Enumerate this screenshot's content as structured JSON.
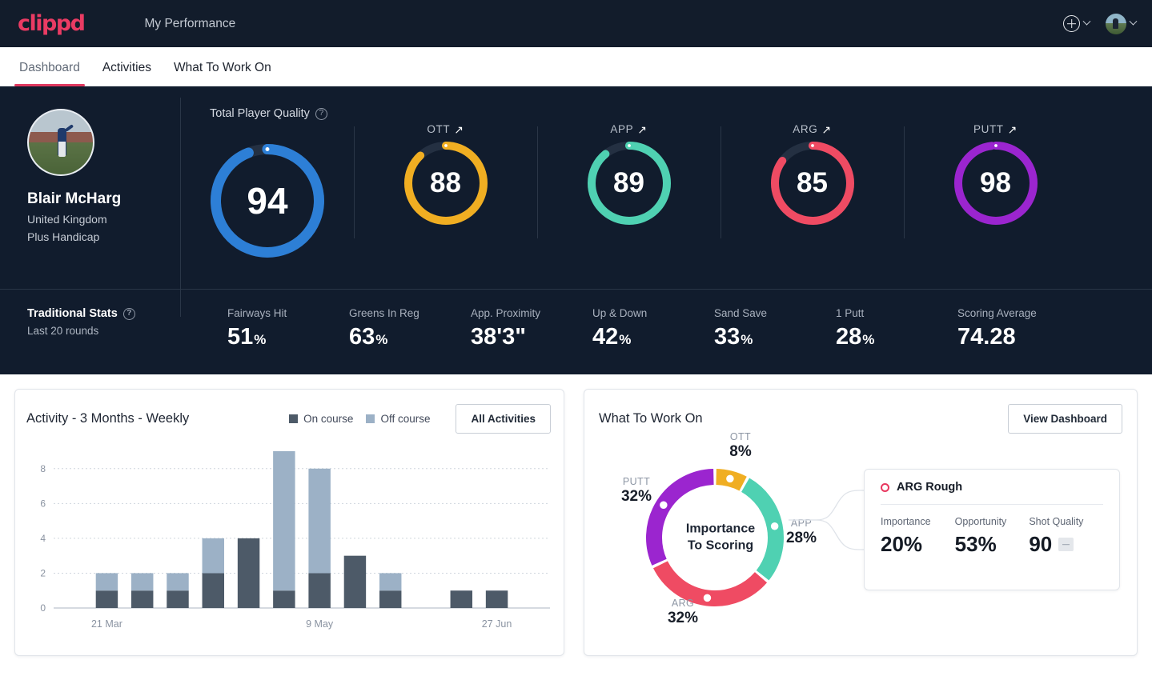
{
  "header": {
    "logo_text": "clippd",
    "app_title": "My Performance",
    "add_icon": "plus-circle-icon",
    "add_chevron": "chevron-down-icon",
    "avatar_icon": "user-avatar",
    "avatar_chevron": "chevron-down-icon"
  },
  "tabs": [
    {
      "label": "Dashboard",
      "active": true
    },
    {
      "label": "Activities",
      "active": false
    },
    {
      "label": "What To Work On",
      "active": false
    }
  ],
  "player": {
    "name": "Blair McHarg",
    "country": "United Kingdom",
    "handicap": "Plus Handicap"
  },
  "tpq": {
    "label": "Total Player Quality",
    "help_icon": "question-mark-icon",
    "value": "94",
    "color": "#2d7fd6",
    "percent": 94
  },
  "skills": [
    {
      "key": "OTT",
      "value": "88",
      "percent": 88,
      "color": "#f0ae22",
      "trend_icon": "arrow-up-right-icon",
      "trend": "↗"
    },
    {
      "key": "APP",
      "value": "89",
      "percent": 89,
      "color": "#4fd1b2",
      "trend_icon": "arrow-up-right-icon",
      "trend": "↗"
    },
    {
      "key": "ARG",
      "value": "85",
      "percent": 85,
      "color": "#ef4b63",
      "trend_icon": "arrow-up-right-icon",
      "trend": "↗"
    },
    {
      "key": "PUTT",
      "value": "98",
      "percent": 98,
      "color": "#9b25cf",
      "trend_icon": "arrow-up-right-icon",
      "trend": "↗"
    }
  ],
  "traditional": {
    "title": "Traditional Stats",
    "help_icon": "question-mark-icon",
    "subtitle": "Last 20 rounds",
    "stats": [
      {
        "label": "Fairways Hit",
        "value": "51",
        "unit": "%"
      },
      {
        "label": "Greens In Reg",
        "value": "63",
        "unit": "%"
      },
      {
        "label": "App. Proximity",
        "value": "38'3\"",
        "unit": ""
      },
      {
        "label": "Up & Down",
        "value": "42",
        "unit": "%"
      },
      {
        "label": "Sand Save",
        "value": "33",
        "unit": "%"
      },
      {
        "label": "1 Putt",
        "value": "28",
        "unit": "%"
      },
      {
        "label": "Scoring Average",
        "value": "74.28",
        "unit": ""
      }
    ]
  },
  "activity_card": {
    "title": "Activity - 3 Months - Weekly",
    "legend": [
      {
        "label": "On course",
        "color": "#4d5a68"
      },
      {
        "label": "Off course",
        "color": "#9cb1c6"
      }
    ],
    "button": "All Activities"
  },
  "wtwo_card": {
    "title": "What To Work On",
    "button": "View Dashboard",
    "center_line1": "Importance",
    "center_line2": "To Scoring",
    "detail": {
      "marker_icon": "circle-outline-icon",
      "title": "ARG Rough",
      "marker_color": "#e8385f",
      "stats": [
        {
          "label": "Importance",
          "value": "20%"
        },
        {
          "label": "Opportunity",
          "value": "53%"
        },
        {
          "label": "Shot Quality",
          "value": "90",
          "badge_icon": "minus-badge-icon"
        }
      ]
    }
  },
  "chart_data": [
    {
      "type": "bar",
      "title": "Activity - 3 Months - Weekly",
      "stacked": true,
      "xlabel": "",
      "ylabel": "",
      "ylim": [
        0,
        9
      ],
      "yticks": [
        0,
        2,
        4,
        6,
        8
      ],
      "grid": true,
      "legend_position": "top-right",
      "categories": [
        "w1",
        "w2",
        "w3",
        "w4",
        "w5",
        "w6",
        "w7",
        "w8",
        "w9",
        "w10",
        "w11",
        "w12",
        "w13",
        "w14"
      ],
      "tick_labels": [
        {
          "index": 1,
          "label": "21 Mar"
        },
        {
          "index": 7,
          "label": "9 May"
        },
        {
          "index": 12,
          "label": "27 Jun"
        }
      ],
      "series": [
        {
          "name": "On course",
          "color": "#4d5a68",
          "values": [
            0,
            1,
            1,
            1,
            2,
            4,
            1,
            2,
            3,
            1,
            0,
            1,
            1,
            0
          ]
        },
        {
          "name": "Off course",
          "color": "#9cb1c6",
          "values": [
            0,
            1,
            1,
            1,
            2,
            0,
            8,
            6,
            0,
            1,
            0,
            0,
            0,
            0
          ]
        }
      ]
    },
    {
      "type": "pie",
      "title": "Importance To Scoring",
      "donut": true,
      "labels": [
        "OTT",
        "APP",
        "ARG",
        "PUTT"
      ],
      "values": [
        8,
        28,
        32,
        32
      ],
      "display_values": [
        "8%",
        "28%",
        "32%",
        "32%"
      ],
      "colors": [
        "#f0ae22",
        "#4fd1b2",
        "#ef4b63",
        "#9b25cf"
      ]
    }
  ]
}
